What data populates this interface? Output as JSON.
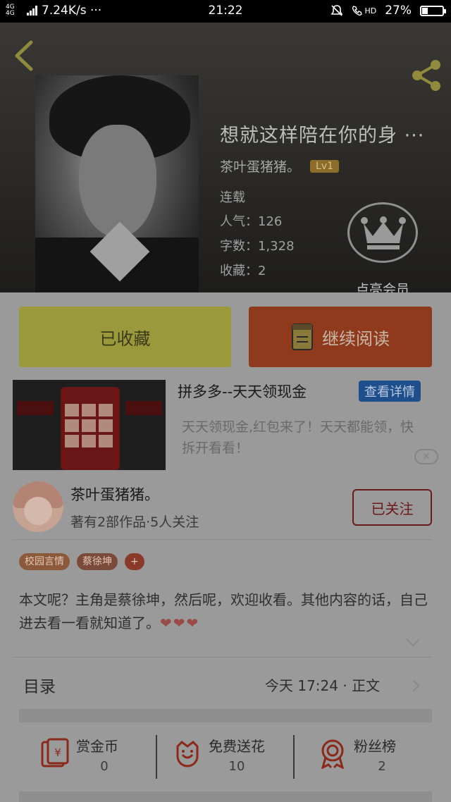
{
  "status_bar": {
    "network": "4G 4G",
    "speed": "7.24K/s ···",
    "time": "21:22",
    "hd": "HD",
    "battery": "27%",
    "battery_level": 0.27
  },
  "header": {
    "book_title": "想就这样陪在你的身 ···",
    "author": "茶叶蛋猪猪。",
    "level_badge": "Lv1",
    "status": "连载",
    "popularity": "人气：126",
    "word_count": "字数：1,328",
    "favorites": "收藏：2",
    "vip_label": "点亮会员"
  },
  "actions": {
    "collected_label": "已收藏",
    "continue_label": "继续阅读"
  },
  "ad": {
    "title": "拼多多--天天领现金",
    "detail_button": "查看详情",
    "description": "天天领现金,红包来了！天天都能领，快拆开看看！",
    "close_label": "✕"
  },
  "author_card": {
    "name": "茶叶蛋猪猪。",
    "stats": "著有2部作品·5人关注",
    "follow_label": "已关注"
  },
  "tags": [
    {
      "label": "校园言情",
      "color": "#8c5a3a"
    },
    {
      "label": "蔡徐坤",
      "color": "#7a4a3a"
    },
    {
      "label": "+",
      "color": "#8a3a2a"
    }
  ],
  "intro": {
    "text": "本文呢？主角是蔡徐坤，然后呢，欢迎收看。其他内容的话，自己进去看一看就知道了。",
    "hearts": "❤❤❤"
  },
  "toc": {
    "label": "目录",
    "info": "今天 17:24 · 正文"
  },
  "stats": [
    {
      "label": "赏金币",
      "count": "0"
    },
    {
      "label": "免费送花",
      "count": "10"
    },
    {
      "label": "粉丝榜",
      "count": "2"
    }
  ],
  "colors": {
    "accent_orange": "#8f3a1c",
    "accent_yellow": "#9a9a3c",
    "icon_red": "#8a2a1a",
    "gold": "#8a7a3a"
  }
}
